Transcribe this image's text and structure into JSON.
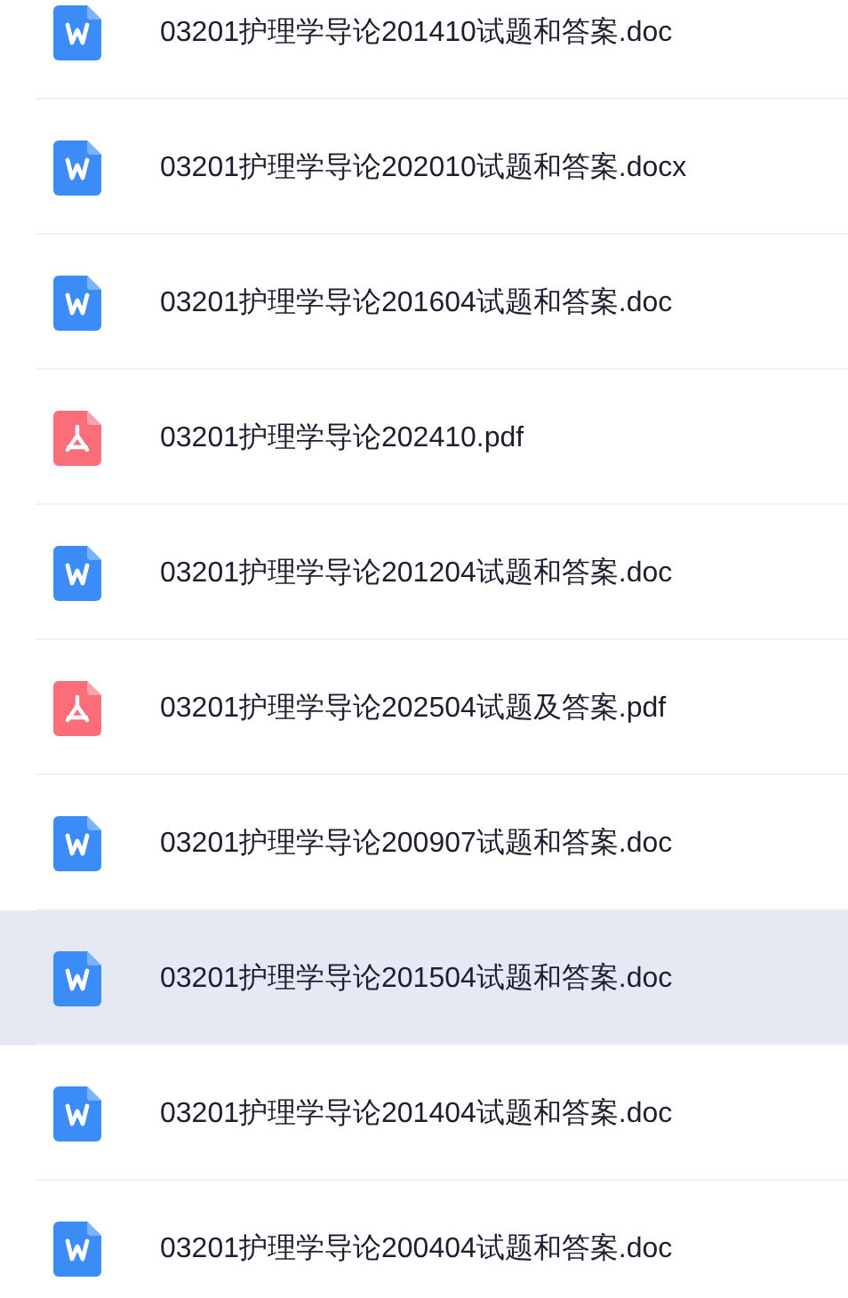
{
  "files": [
    {
      "kind": "word",
      "name": "03201护理学导论201410试题和答案.doc",
      "selected": false
    },
    {
      "kind": "word",
      "name": "03201护理学导论202010试题和答案.docx",
      "selected": false
    },
    {
      "kind": "word",
      "name": "03201护理学导论201604试题和答案.doc",
      "selected": false
    },
    {
      "kind": "pdf",
      "name": "03201护理学导论202410.pdf",
      "selected": false
    },
    {
      "kind": "word",
      "name": "03201护理学导论201204试题和答案.doc",
      "selected": false
    },
    {
      "kind": "pdf",
      "name": "03201护理学导论202504试题及答案.pdf",
      "selected": false
    },
    {
      "kind": "word",
      "name": "03201护理学导论200907试题和答案.doc",
      "selected": false
    },
    {
      "kind": "word",
      "name": "03201护理学导论201504试题和答案.doc",
      "selected": true
    },
    {
      "kind": "word",
      "name": "03201护理学导论201404试题和答案.doc",
      "selected": false
    },
    {
      "kind": "word",
      "name": "03201护理学导论200404试题和答案.doc",
      "selected": false
    }
  ]
}
